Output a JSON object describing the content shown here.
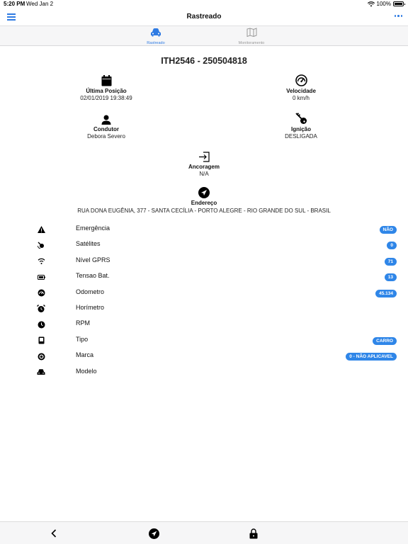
{
  "status": {
    "time": "5:20 PM",
    "date": "Wed Jan 2",
    "battery": "100%"
  },
  "nav": {
    "title": "Rastreado"
  },
  "tabs": [
    {
      "label": "Rastreado",
      "icon": "car-icon",
      "active": true
    },
    {
      "label": "Monitoramento",
      "icon": "map-icon",
      "active": false
    }
  ],
  "vehicle": {
    "title": "ITH2546 - 250504818"
  },
  "info": {
    "ultima_posicao": {
      "title": "Última Posição",
      "value": "02/01/2019 19:38:49"
    },
    "velocidade": {
      "title": "Velocidade",
      "value": "0 km/h"
    },
    "condutor": {
      "title": "Condutor",
      "value": "Debora Severo"
    },
    "ignicao": {
      "title": "Ignição",
      "value": "DESLIGADA"
    },
    "ancoragem": {
      "title": "Ancoragem",
      "value": "N/A"
    },
    "endereco": {
      "title": "Endereço",
      "value": "RUA DONA EUGÊNIA, 377 - SANTA CECÍLIA - PORTO ALEGRE - RIO GRANDE DO SUL - BRASIL"
    }
  },
  "rows": [
    {
      "label": "Emergência",
      "badge": "NÃO",
      "icon": "warning-icon"
    },
    {
      "label": "Satélites",
      "badge": "0",
      "icon": "satellite-icon"
    },
    {
      "label": "Nível GPRS",
      "badge": "71",
      "icon": "wifi-icon"
    },
    {
      "label": "Tensao Bat.",
      "badge": "13",
      "icon": "battery-icon"
    },
    {
      "label": "Odometro",
      "badge": "45.134",
      "icon": "gauge-icon"
    },
    {
      "label": "Horímetro",
      "badge": "",
      "icon": "alarm-clock-icon"
    },
    {
      "label": "RPM",
      "badge": "",
      "icon": "clock-icon"
    },
    {
      "label": "Tipo",
      "badge": "CARRO",
      "icon": "device-icon"
    },
    {
      "label": "Marca",
      "badge": "0 - NÃO APLICAVEL",
      "icon": "target-icon"
    },
    {
      "label": "Modelo",
      "badge": "",
      "icon": "car-icon"
    }
  ],
  "colors": {
    "accent": "#2f7be3",
    "badge": "#2f86e8"
  }
}
